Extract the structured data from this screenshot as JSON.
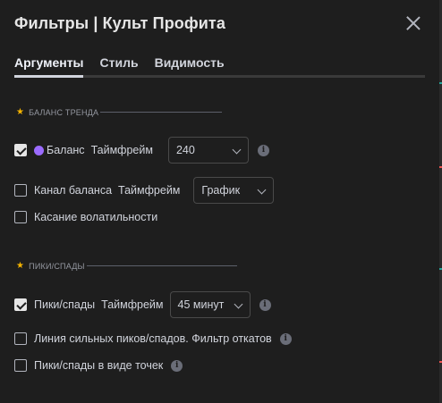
{
  "dialog": {
    "title": "Фильтры | Культ Профита",
    "close_icon": "close-icon"
  },
  "tabs": [
    {
      "label": "Аргументы",
      "active": true
    },
    {
      "label": "Стиль",
      "active": false
    },
    {
      "label": "Видимость",
      "active": false
    }
  ],
  "sections": {
    "trend_balance": {
      "title": "БАЛАНС ТРЕНДА",
      "icon": "star-icon"
    },
    "peaks": {
      "title": "ПИКИ/СПАДЫ",
      "icon": "star-icon"
    }
  },
  "balance": {
    "label": "Баланс",
    "checked": true,
    "color": "#9b6bff",
    "timeframe_label": "Таймфрейм",
    "timeframe_value": "240",
    "info_icon": "info-icon"
  },
  "balance_channel": {
    "label": "Канал баланса",
    "checked": false,
    "timeframe_label": "Таймфрейм",
    "timeframe_value": "График"
  },
  "volatility_touch": {
    "label": "Касание волатильности",
    "checked": false
  },
  "peaks_row": {
    "label": "Пики/спады",
    "checked": true,
    "timeframe_label": "Таймфрейм",
    "timeframe_value": "45 минут",
    "info_icon": "info-icon"
  },
  "strong_peaks": {
    "label": "Линия сильных пиков/спадов. Фильтр откатов",
    "checked": false,
    "info_icon": "info-icon"
  },
  "peaks_dots": {
    "label": "Пики/спады в виде точек",
    "checked": false,
    "info_icon": "info-icon"
  },
  "colors": {
    "background": "#1e1e1e",
    "text": "#d1d4dc",
    "star": "#f5b400"
  }
}
